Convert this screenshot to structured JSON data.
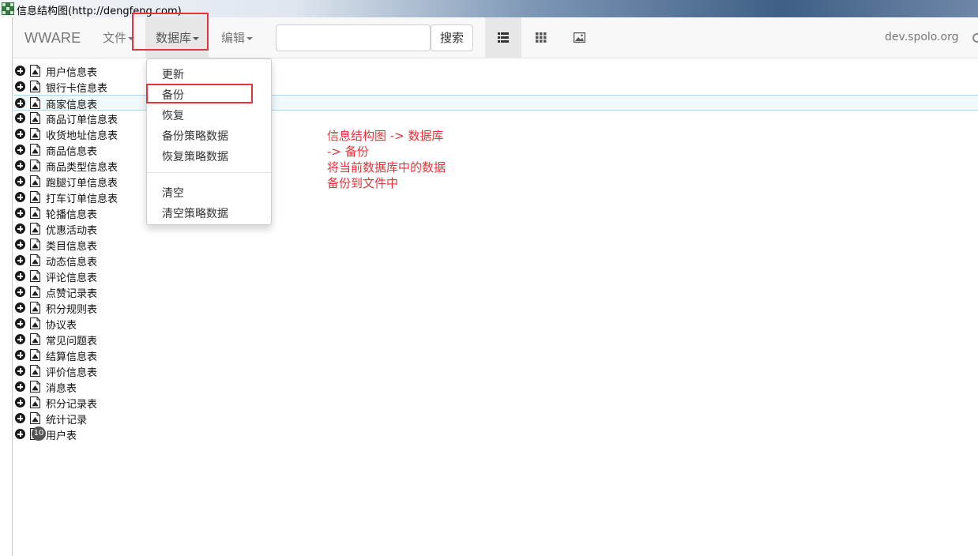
{
  "window": {
    "title": "信息结构图(http://dengfeng.com)",
    "icon": "app-grid-icon"
  },
  "navbar": {
    "brand": "WWARE",
    "menus": [
      {
        "label": "文件",
        "icon": "caret-down-icon"
      },
      {
        "label": "数据库",
        "icon": "caret-down-icon",
        "active": true
      },
      {
        "label": "编辑",
        "icon": "caret-down-icon"
      }
    ],
    "search": {
      "value": "",
      "placeholder": "",
      "button_label": "搜索"
    },
    "views": [
      {
        "icon": "list-icon",
        "active": true
      },
      {
        "icon": "grid-icon",
        "active": false
      },
      {
        "icon": "image-icon",
        "active": false
      }
    ],
    "host": "dev.spolo.org"
  },
  "dropdown": {
    "items": [
      "更新",
      "备份",
      "恢复",
      "备份策略数据",
      "恢复策略数据"
    ],
    "items_after_divider": [
      "清空",
      "清空策略数据"
    ],
    "highlighted": "备份"
  },
  "tree": {
    "selected_index": 2,
    "badge": "10",
    "items": [
      "用户信息表",
      "银行卡信息表",
      "商家信息表",
      "商品订单信息表",
      "收货地址信息表",
      "商品信息表",
      "商品类型信息表",
      "跑腿订单信息表",
      "打车订单信息表",
      "轮播信息表",
      "优惠活动表",
      "类目信息表",
      "动态信息表",
      "评论信息表",
      "点赞记录表",
      "积分规则表",
      "协议表",
      "常见问题表",
      "结算信息表",
      "评价信息表",
      "消息表",
      "积分记录表",
      "统计记录",
      "用户表"
    ]
  },
  "annotation": {
    "lines": [
      "信息结构图 -> 数据库",
      "-> 备份",
      "将当前数据库中的数据",
      "备份到文件中"
    ]
  },
  "colors": {
    "highlight": "#e3333b",
    "navbar_bg": "#f8f8f8",
    "selected_row_bg": "#f0f9fc"
  }
}
